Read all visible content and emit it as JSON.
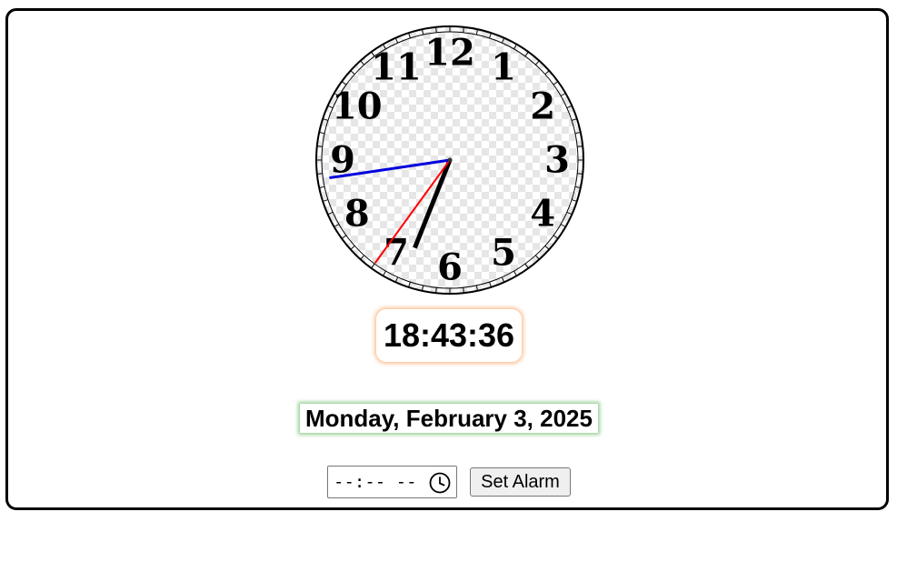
{
  "clock": {
    "numerals": [
      "12",
      "1",
      "2",
      "3",
      "4",
      "5",
      "6",
      "7",
      "8",
      "9",
      "10",
      "11"
    ],
    "time": {
      "hours": 18,
      "minutes": 43,
      "seconds": 36
    },
    "colors": {
      "hour_hand": "#000000",
      "minute_hand": "#0000dd",
      "second_hand": "#ff0000",
      "face_check": "#e6e6e6",
      "rim": "#000000"
    }
  },
  "digital_time": "18:43:36",
  "date_text": "Monday, February 3, 2025",
  "alarm": {
    "time_placeholder": "--:-- --",
    "time_icon": "clock-icon",
    "button_label": "Set Alarm"
  },
  "accent": {
    "time_glow": "#ff8c3c",
    "date_glow": "#3caa3c"
  }
}
